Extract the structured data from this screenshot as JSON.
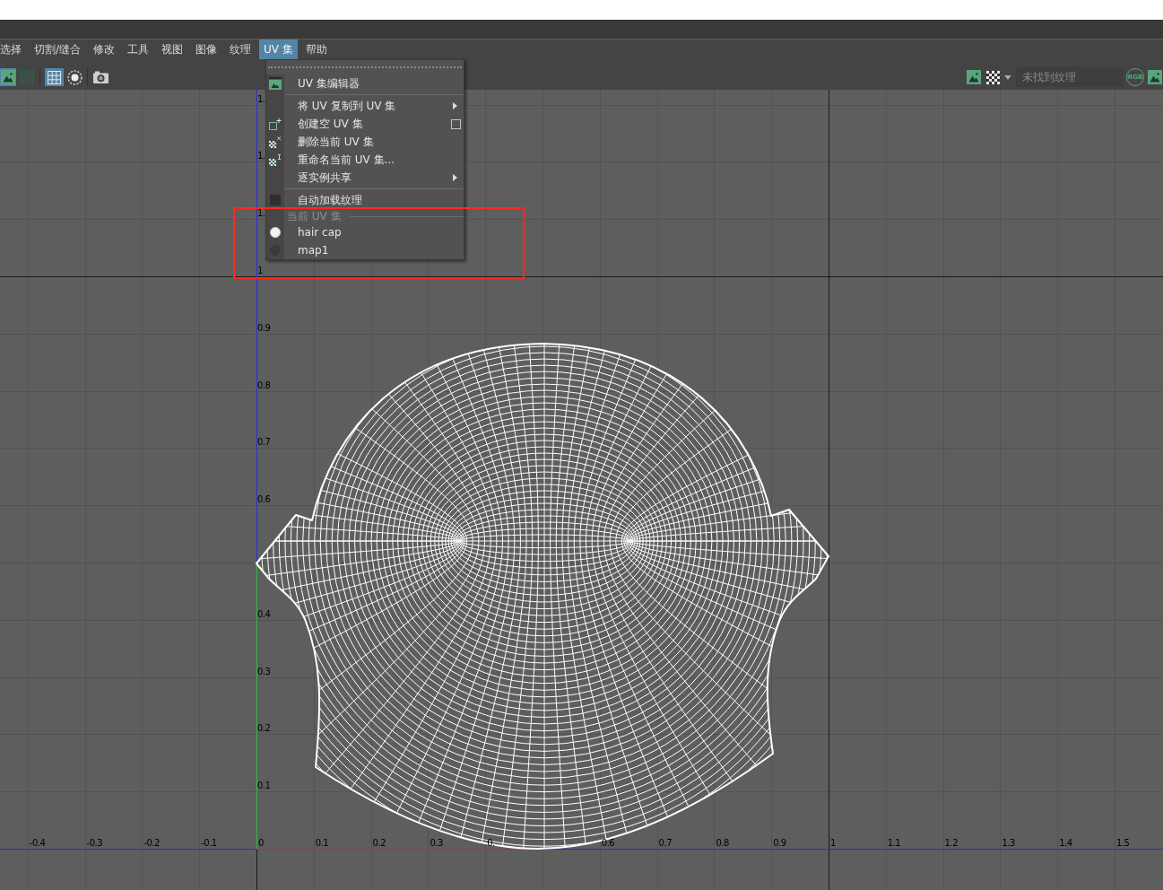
{
  "menu_bar": {
    "items": [
      {
        "label": "选择",
        "selected": false
      },
      {
        "label": "切割/缝合",
        "selected": false
      },
      {
        "label": "修改",
        "selected": false
      },
      {
        "label": "工具",
        "selected": false
      },
      {
        "label": "视图",
        "selected": false
      },
      {
        "label": "图像",
        "selected": false
      },
      {
        "label": "纹理",
        "selected": false
      },
      {
        "label": "UV 集",
        "selected": true
      },
      {
        "label": "帮助",
        "selected": false
      }
    ]
  },
  "toolbar": {
    "left": [
      {
        "kind": "image",
        "selected": true
      },
      {
        "kind": "frame",
        "selected": false
      },
      {
        "kind": "separator"
      },
      {
        "kind": "grid",
        "selected": true
      },
      {
        "kind": "ring",
        "selected": false
      },
      {
        "kind": "separator"
      },
      {
        "kind": "camera",
        "selected": false
      }
    ],
    "right": [
      {
        "kind": "image"
      },
      {
        "kind": "checker"
      },
      {
        "kind": "caret"
      },
      {
        "kind": "field",
        "value": "未找到纹理"
      },
      {
        "kind": "rgb",
        "label": "RGB"
      },
      {
        "kind": "image"
      }
    ]
  },
  "uv_set_menu": {
    "items": [
      {
        "kind": "command",
        "label": "UV 集编辑器"
      },
      {
        "kind": "separator"
      },
      {
        "kind": "submenu",
        "label": "将 UV 复制到 UV 集"
      },
      {
        "kind": "option",
        "label": "创建空 UV 集"
      },
      {
        "kind": "command",
        "label": "删除当前 UV 集"
      },
      {
        "kind": "command",
        "label": "重命名当前 UV 集..."
      },
      {
        "kind": "submenu",
        "label": "逐实例共享"
      },
      {
        "kind": "separator"
      },
      {
        "kind": "checkbox",
        "label": "自动加载纹理",
        "checked": false
      },
      {
        "kind": "header",
        "label": "当前 UV 集"
      },
      {
        "kind": "radio",
        "label": "hair cap",
        "selected": true
      },
      {
        "kind": "radio",
        "label": "map1",
        "selected": false
      }
    ]
  },
  "uv_editor": {
    "u_labels": [
      "-0.4",
      "-0.3",
      "-0.2",
      "-0.1",
      "0",
      "0.1",
      "0.2",
      "0.3",
      "0.",
      "0.6",
      "0.7",
      "0.8",
      "0.9",
      "1",
      "1.1",
      "1.2",
      "1.3",
      "1.4",
      "1.5"
    ],
    "v_labels": [
      "1.",
      "1.",
      "1.",
      "1",
      "0.9",
      "0.8",
      "0.7",
      "0.6",
      "0.4",
      "0.3",
      "0.2",
      "0.1"
    ]
  }
}
